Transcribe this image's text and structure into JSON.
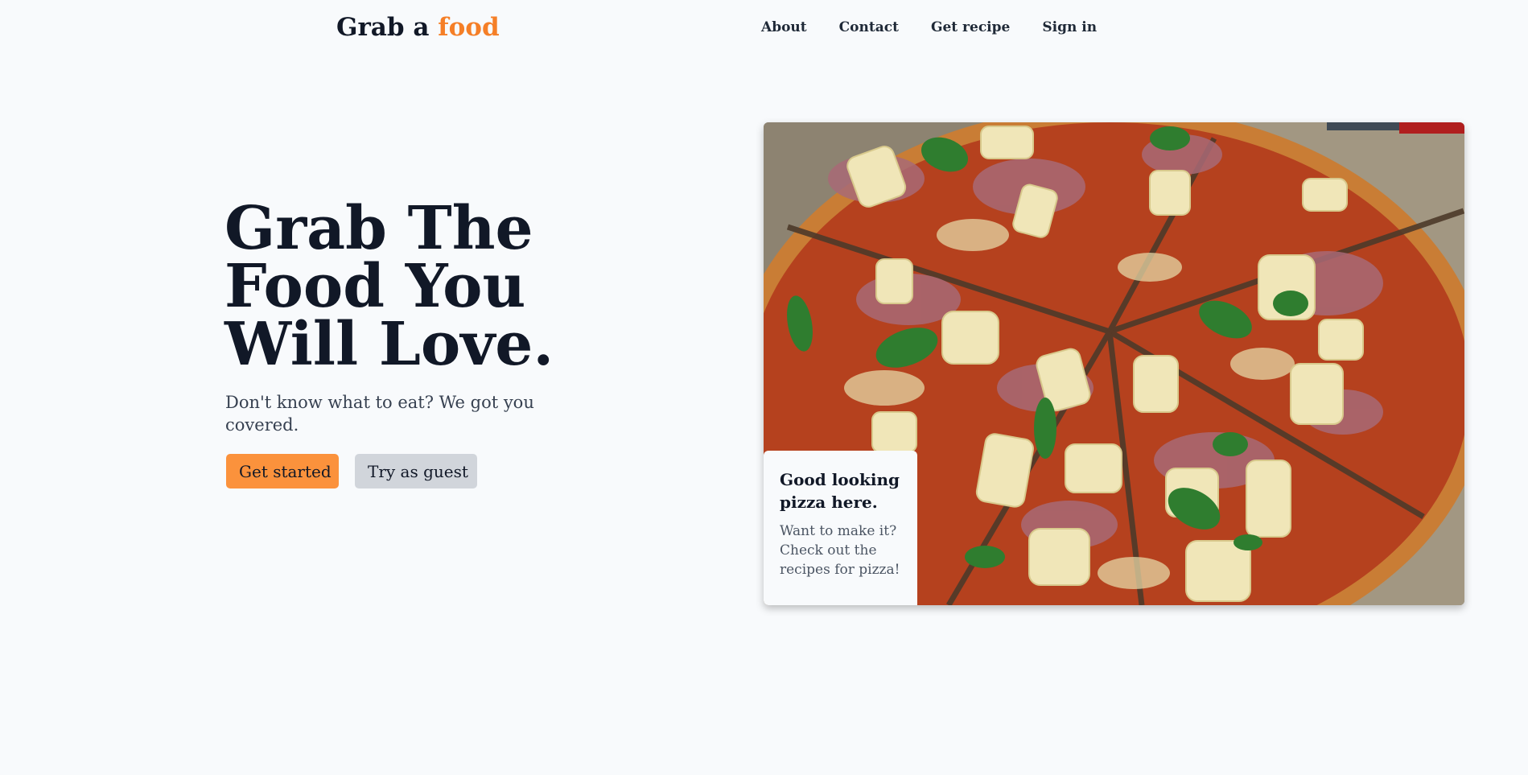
{
  "logo": {
    "text": "Grab a",
    "accent": "food",
    "accent_color": "#f57f27"
  },
  "nav": {
    "items": [
      "About",
      "Contact",
      "Get recipe",
      "Sign in"
    ]
  },
  "hero": {
    "title": "Grab The Food You Will Love.",
    "subtitle": "Don't know what to eat? We got you covered.",
    "primary_button": "Get started",
    "secondary_button": "Try as guest",
    "primary_color": "#fb923c",
    "secondary_color": "#d1d5db"
  },
  "image": {
    "subject": "pizza-photo"
  },
  "card": {
    "title": "Good looking pizza here.",
    "text": "Want to make it? Check out the recipes for pizza!"
  }
}
